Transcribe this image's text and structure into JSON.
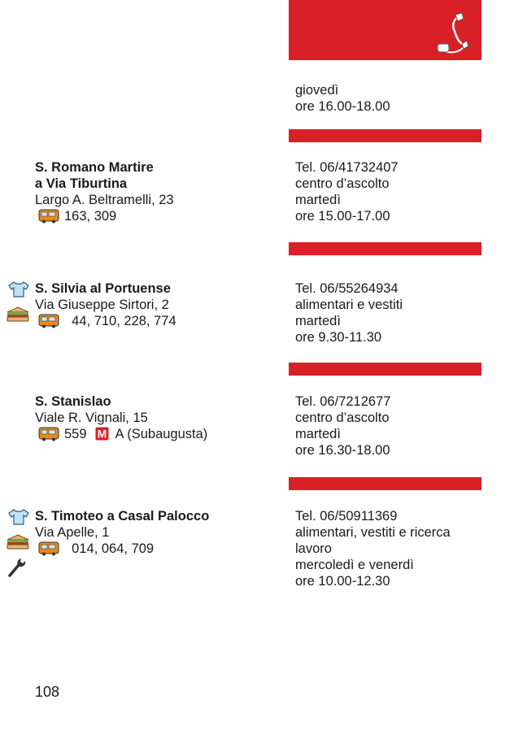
{
  "header": {
    "continued": [
      "giovedì",
      "ore 16.00-18.00"
    ]
  },
  "entries": [
    {
      "name": [
        "S. Romano Martire",
        "a Via Tiburtina"
      ],
      "address": "Largo A. Beltramelli, 23",
      "bus": "163, 309",
      "details": [
        "Tel. 06/41732407",
        "centro d’ascolto",
        "martedì",
        "ore 15.00-17.00"
      ]
    },
    {
      "name": [
        "S. Silvia al Portuense"
      ],
      "address": "Via Giuseppe Sirtori, 2",
      "bus": "44, 710, 228, 774",
      "details": [
        "Tel. 06/55264934",
        "alimentari e vestiti",
        "martedì",
        "ore 9.30-11.30"
      ]
    },
    {
      "name": [
        "S. Stanislao"
      ],
      "address": "Viale R. Vignali, 15",
      "bus": "559",
      "metro": "A (Subaugusta)",
      "details": [
        "Tel. 06/7212677",
        "centro d’ascolto",
        "martedì",
        "ore 16.30-18.00"
      ]
    },
    {
      "name": [
        "S. Timoteo a Casal Palocco"
      ],
      "address": "Via Apelle, 1",
      "bus": "014, 064, 709",
      "details": [
        "Tel. 06/50911369",
        "alimentari, vestiti e ricerca",
        "lavoro",
        "mercoledì e venerdì",
        "ore 10.00-12.30"
      ]
    }
  ],
  "metro_letter": "M",
  "page_number": "108",
  "colors": {
    "accent_red": "#d92027",
    "bus_orange": "#e98a1a"
  },
  "icons": [
    "phone-icon",
    "clothes-icon",
    "food-icon",
    "bus-icon",
    "metro-icon",
    "wrench-icon"
  ]
}
